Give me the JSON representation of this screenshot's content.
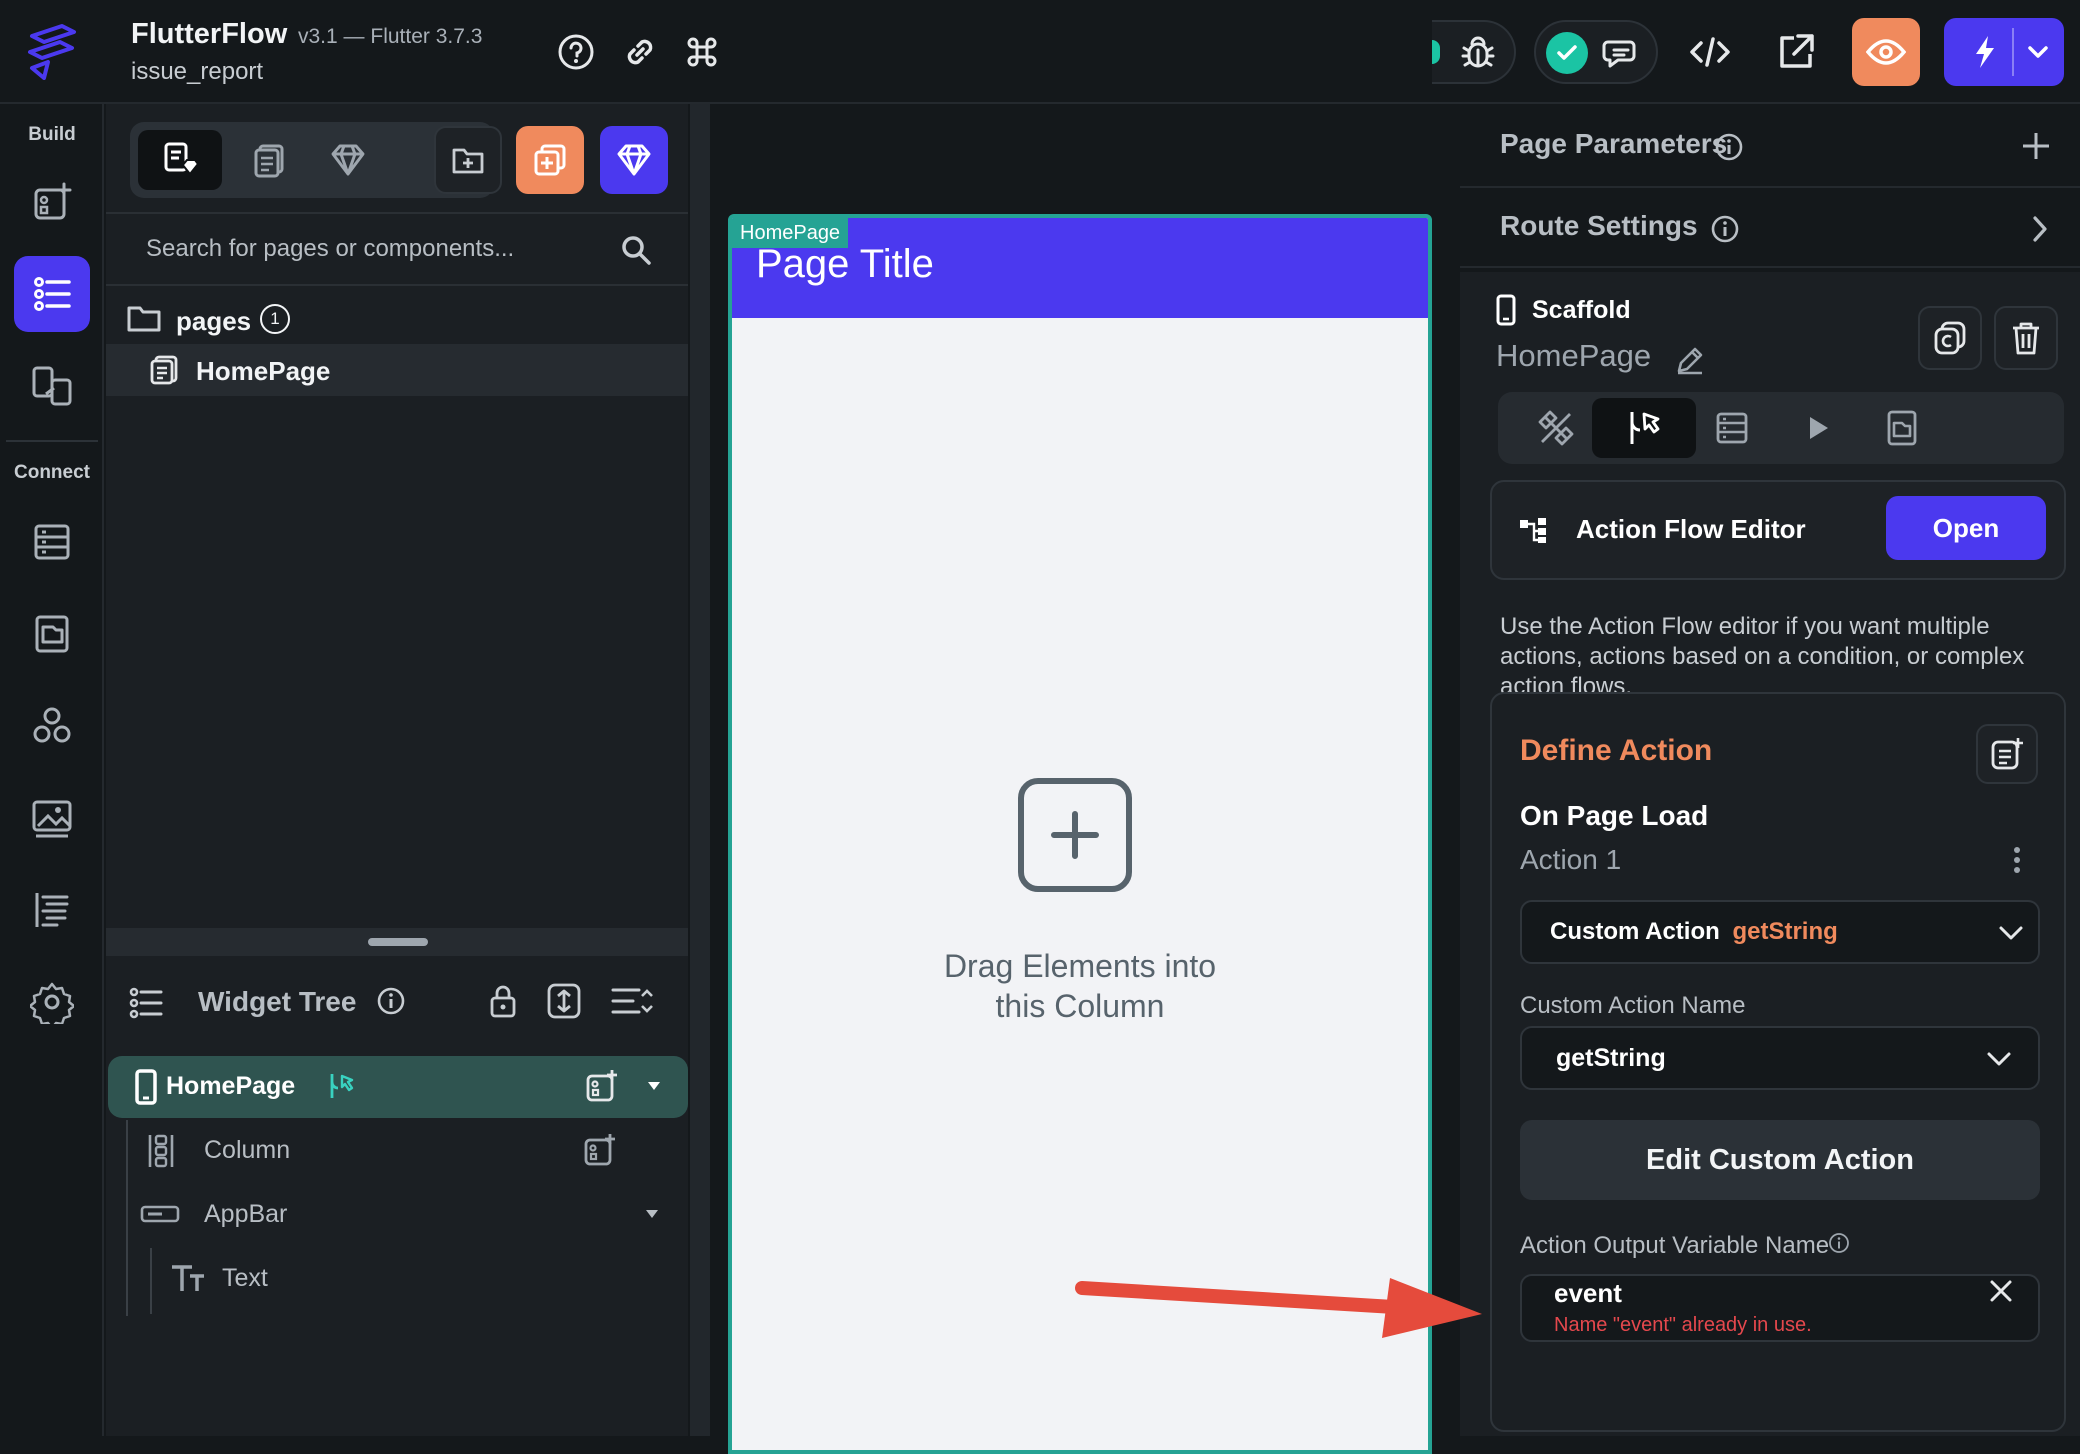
{
  "topbar": {
    "app_name": "FlutterFlow",
    "version": "v3.1 — Flutter 3.7.3",
    "project_name": "issue_report",
    "icons": [
      "help-icon",
      "link-icon",
      "command-icon",
      "bug-icon",
      "check-circle-icon",
      "chat-icon",
      "code-icon",
      "external-link-icon",
      "eye-icon",
      "lightning-icon",
      "chevron-down-icon"
    ],
    "accent_orange": "#f08a5d",
    "accent_purple": "#4b39ef",
    "check_color": "#1bc4a4"
  },
  "rail": {
    "build_label": "Build",
    "connect_label": "Connect",
    "items": [
      "add-widget-icon",
      "widget-tree-icon",
      "storyboard-icon",
      "firestore-icon",
      "media-icon",
      "integrations-icon",
      "assets-icon",
      "custom-code-icon",
      "settings-icon"
    ]
  },
  "explorer": {
    "search_placeholder": "Search for pages or components...",
    "pages_label": "pages",
    "pages_count": "1",
    "homepage_label": "HomePage",
    "widget_tree_title": "Widget Tree",
    "tree": {
      "root": "HomePage",
      "column": "Column",
      "appbar": "AppBar",
      "text": "Text"
    }
  },
  "canvas": {
    "page_tag": "HomePage",
    "page_title": "Page Title",
    "drop_line1": "Drag Elements into",
    "drop_line2": "this Column",
    "appbar_color": "#4b39ef",
    "frame_color": "#25a394"
  },
  "right_panel": {
    "page_parameters": "Page Parameters",
    "route_settings": "Route Settings",
    "scaffold_label": "Scaffold",
    "page_name": "HomePage",
    "afe_title": "Action Flow Editor",
    "afe_open": "Open",
    "afe_help": "Use the Action Flow editor if you want multiple actions, actions based on a condition, or complex action flows.",
    "define_action": "Define Action",
    "trigger": "On Page Load",
    "action_label": "Action 1",
    "action_type": "Custom Action",
    "action_name_inline": "getString",
    "custom_action_name_label": "Custom Action Name",
    "custom_action_name_value": "getString",
    "edit_custom_action": "Edit Custom Action",
    "output_var_label": "Action Output Variable Name",
    "output_var_value": "event",
    "output_var_error": "Name \"event\" already in use."
  }
}
